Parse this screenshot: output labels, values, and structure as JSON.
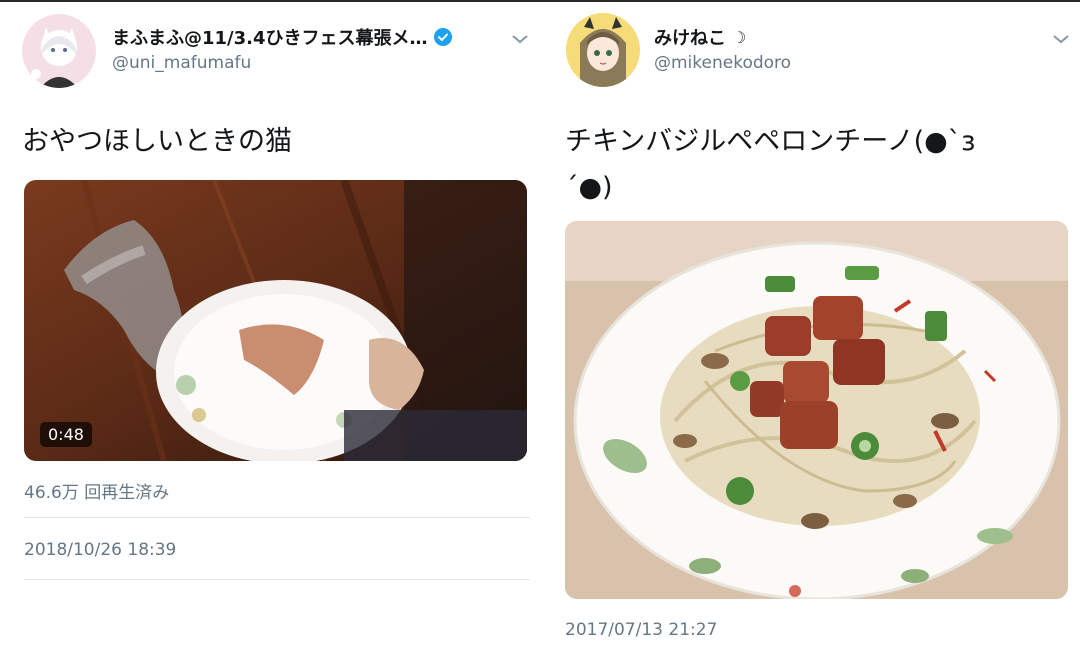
{
  "left_tweet": {
    "display_name": "まふまふ@11/3.4ひきフェス幕張メ…",
    "handle": "@uni_mafumafu",
    "text": "おやつほしいときの猫",
    "video_duration": "0:48",
    "views": "46.6万 回再生済み",
    "timestamp": "2018/10/26 18:39"
  },
  "right_tweet": {
    "display_name": "みけねこ",
    "name_symbol": "☽",
    "handle": "@mikenekodoro",
    "text_line1": "チキンバジルペペロンチーノ(●`з",
    "text_line2": "´●)",
    "timestamp": "2017/07/13 21:27"
  },
  "colors": {
    "verified": "#1da1f2",
    "secondary_text": "#657786",
    "primary_text": "#14171a",
    "divider": "#e1e8ed"
  },
  "icons": [
    "verified-badge-icon",
    "chevron-down-icon",
    "crescent-moon-icon"
  ]
}
